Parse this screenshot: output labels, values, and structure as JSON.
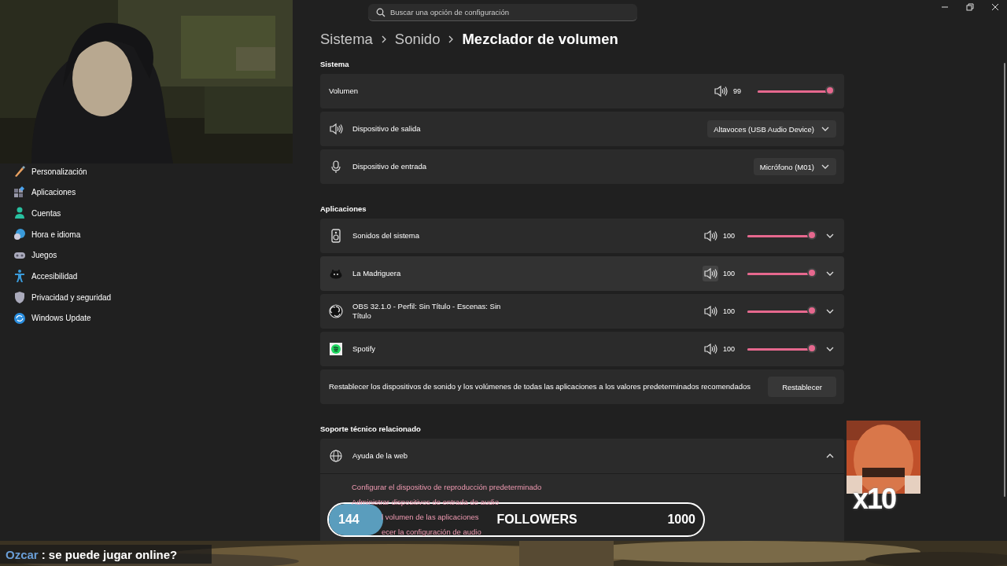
{
  "webcam": {
    "kind": "picture"
  },
  "sidebar": {
    "items": [
      {
        "label": "Personalización"
      },
      {
        "label": "Aplicaciones"
      },
      {
        "label": "Cuentas"
      },
      {
        "label": "Hora e idioma"
      },
      {
        "label": "Juegos"
      },
      {
        "label": "Accesibilidad"
      },
      {
        "label": "Privacidad y seguridad"
      },
      {
        "label": "Windows Update"
      }
    ]
  },
  "search": {
    "placeholder": "Buscar una opción de configuración"
  },
  "breadcrumb": [
    "Sistema",
    "Sonido",
    "Mezclador de volumen"
  ],
  "system": {
    "heading": "Sistema",
    "volume": {
      "label": "Volumen",
      "reading": "99",
      "level": 0.99
    },
    "devices": [
      {
        "label": "Dispositivo de salida",
        "value": "Altavoces (USB Audio Device)"
      },
      {
        "label": "Dispositivo de entrada",
        "value": "Micrófono (M01)"
      }
    ]
  },
  "apps": {
    "heading": "Aplicaciones",
    "items": [
      {
        "name": "Sonidos del sistema",
        "reading": "100",
        "level": 1,
        "hovered": false,
        "expanded": false
      },
      {
        "name": "La Madriguera",
        "reading": "100",
        "level": 1,
        "hovered": true,
        "expanded": false
      },
      {
        "name": "OBS 32.1.0 - Perfil: Sin Título - Escenas: Sin Título",
        "reading": "100",
        "level": 1,
        "hovered": false,
        "expanded": false
      },
      {
        "name": "Spotify",
        "reading": "100",
        "level": 1,
        "hovered": false,
        "expanded": false
      }
    ],
    "reset": {
      "text": "Restablecer los dispositivos de sonido y los volúmenes de todas las aplicaciones a los valores predeterminados recomendados",
      "button": "Restablecer"
    }
  },
  "support": {
    "heading": "Soporte técnico relacionado",
    "help": {
      "title": "Ayuda de la web",
      "expanded": true,
      "links": [
        {
          "text": "Configurar el dispositivo de reproducción predeterminado",
          "covered": false
        },
        {
          "text": "Administrar dispositivos de entrada de audio",
          "covered": false
        },
        {
          "text": "l volumen de las aplicaciones",
          "covered": true
        },
        {
          "text": "ecer la configuración de audio",
          "covered": true
        }
      ]
    }
  },
  "overlay": {
    "followers": {
      "current": "144",
      "label": "FOLLOWERS",
      "goal": "1000",
      "level": 0.144
    },
    "alert": {
      "kind": "picture",
      "text": "x10"
    },
    "chat": {
      "user": "Ozcar",
      "message": ": se puede jugar online?"
    }
  }
}
